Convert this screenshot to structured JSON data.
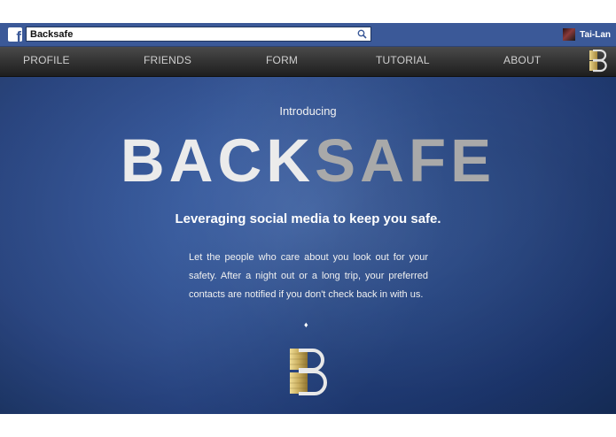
{
  "facebook_bar": {
    "search_value": "Backsafe",
    "user_name": "Tai-Lan",
    "icons": {
      "logo": "facebook-logo-icon",
      "search": "search-icon",
      "avatar": "user-avatar"
    }
  },
  "nav": {
    "items": [
      "PROFILE",
      "FRIENDS",
      "FORM",
      "TUTORIAL",
      "ABOUT"
    ],
    "logo_letter": "B"
  },
  "hero": {
    "intro": "Introducing",
    "title_part1": "BACK",
    "title_part2": "SAFE",
    "tagline": "Leveraging social media to keep you safe.",
    "description": "Let the people who care about you look out for your safety. After a night out or a long trip, your preferred contacts are notified if you don't check back in with us.",
    "divider_glyph": "♦",
    "logo_letter": "B"
  },
  "colors": {
    "facebook_blue": "#3b5998",
    "nav_dark": "#333333",
    "hero_blue": "#2c4f93",
    "title_light": "#ebebeb",
    "title_grey": "#a9a9a9",
    "logo_gold": "#c9ad5e"
  }
}
